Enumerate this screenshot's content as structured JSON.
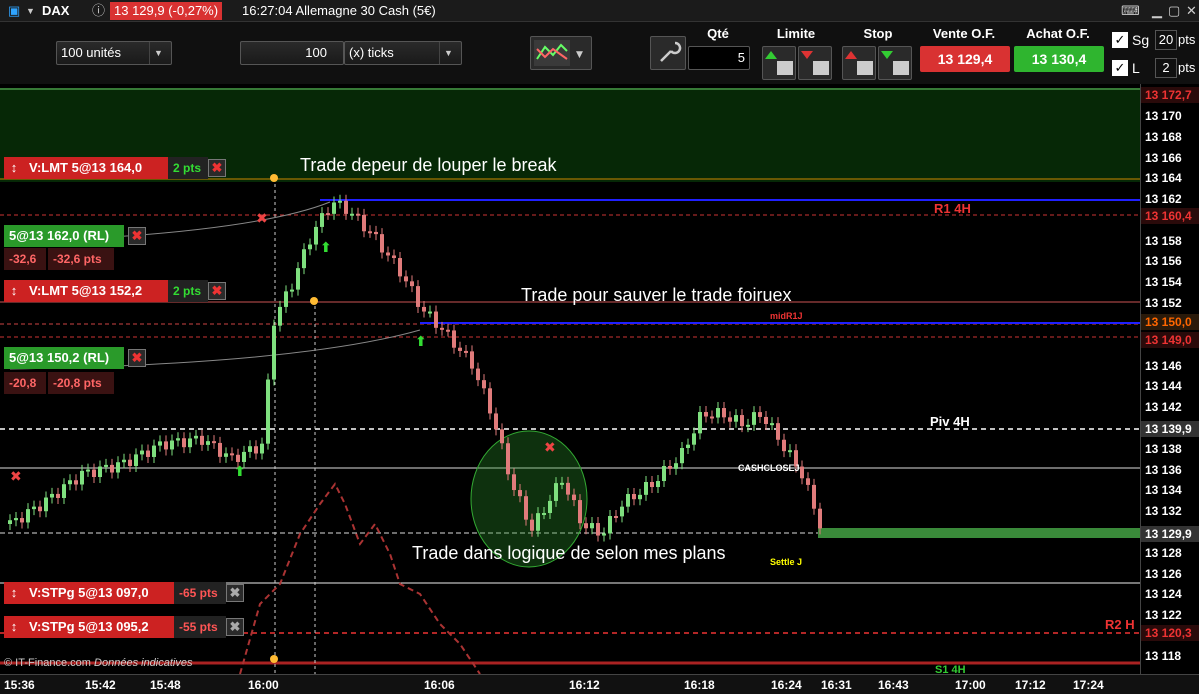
{
  "header": {
    "instrument": "DAX",
    "quote": "13 129,9 (-0,27%)",
    "time_title": "16:27:04 Allemagne 30 Cash (5€)"
  },
  "toolbar": {
    "units": "100 unités",
    "ticks_value": "100",
    "ticks_label": "(x) ticks",
    "qty_label": "Qté",
    "qty_value": "5",
    "limit_label": "Limite",
    "stop_label": "Stop",
    "sell_label": "Vente O.F.",
    "sell_price": "13 129,4",
    "buy_label": "Achat O.F.",
    "buy_price": "13 130,4",
    "sg_label": "Sg",
    "sg_value": "20",
    "sg_unit": "pts",
    "l_label": "L",
    "l_value": "2",
    "l_unit": "pts"
  },
  "orders": [
    {
      "label": "V:LMT 5@13 164,0",
      "pts": "2 pts"
    },
    {
      "label": "5@13 162,0 (RL)",
      "pnl1": "-32,6",
      "pnl2": "-32,6 pts"
    },
    {
      "label": "V:LMT 5@13 152,2",
      "pts": "2 pts"
    },
    {
      "label": "5@13 150,2 (RL)",
      "pnl1": "-20,8",
      "pnl2": "-20,8 pts"
    },
    {
      "label": "V:STPg 5@13 097,0",
      "pts": "-65 pts"
    },
    {
      "label": "V:STPg 5@13 095,2",
      "pts": "-55 pts"
    }
  ],
  "annotations": {
    "a1": "Trade depeur de louper le break",
    "a2": "Trade pour sauver le trade foiruex",
    "a3": "Trade dans logique de selon mes plans"
  },
  "levels": {
    "r1": "R1 4H",
    "midr1": "midR1J",
    "piv": "Piv 4H",
    "cash": "CASHCLOSEJ",
    "settle": "Settle J",
    "r2": "R2 H",
    "s1": "S1 4H"
  },
  "yaxis": {
    "ticks": [
      "13 170",
      "13 168",
      "13 166",
      "13 164",
      "13 162",
      "13 158",
      "13 156",
      "13 154",
      "13 152",
      "13 146",
      "13 144",
      "13 142",
      "13 138",
      "13 136",
      "13 134",
      "13 132",
      "13 128",
      "13 126",
      "13 124",
      "13 122",
      "13 118"
    ],
    "highlights": {
      "h1": "13 172,7",
      "h2": "13 160,4",
      "h3": "13 150,0",
      "h4": "13 149,0",
      "h5": "13 139,9",
      "h6": "13 129,9",
      "h7": "13 120,3"
    }
  },
  "xaxis": [
    "15:36",
    "15:42",
    "15:48",
    "16:00",
    "16:06",
    "16:12",
    "16:18",
    "16:24",
    "16:31",
    "16:43",
    "17:00",
    "17:12",
    "17:24"
  ],
  "footer": {
    "source": "© IT-Finance.com",
    "note": "Données indicatives"
  },
  "colors": {
    "up": "#7fe07f",
    "down": "#e07b7b",
    "green_btn": "#2fb52f",
    "red_btn": "#d93232",
    "blue_line": "#2020ff"
  }
}
